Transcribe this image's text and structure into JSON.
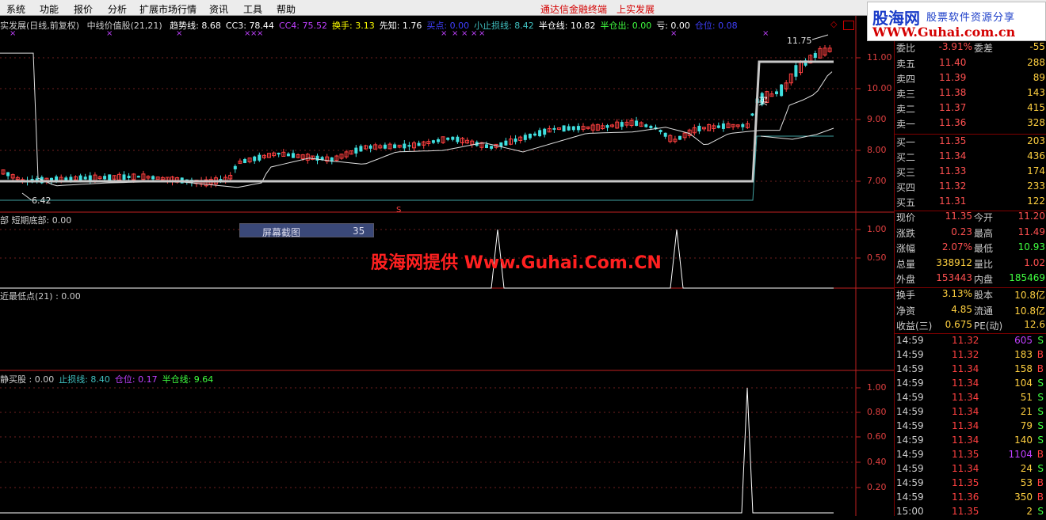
{
  "menu": {
    "items": [
      "系统",
      "功能",
      "报价",
      "分析",
      "扩展市场行情",
      "资讯",
      "工具",
      "帮助"
    ],
    "links": [
      "通达信金融终端",
      "上实发展"
    ]
  },
  "logo": {
    "name": "股海网",
    "tag": "股票软件资源分享",
    "url": "WWW.Guhai.com.cn"
  },
  "main": {
    "title": "实发展(日线,前复权)",
    "indicator": "中线价值股(21,21)",
    "values": [
      {
        "label": "趋势线: 8.68",
        "color": "#ffffff"
      },
      {
        "label": "CC3: 78.44",
        "color": "#ffffff"
      },
      {
        "label": "CC4: 75.52",
        "color": "#c040ff"
      },
      {
        "label": "换手: 3.13",
        "color": "#ffff00"
      },
      {
        "label": "先知: 1.76",
        "color": "#ffffff"
      },
      {
        "label": "买点: 0.00",
        "color": "#4040ff"
      },
      {
        "label": "小止损线: 8.42",
        "color": "#40c0c0"
      },
      {
        "label": "半仓线: 10.82",
        "color": "#ffffff"
      },
      {
        "label": "半仓出: 0.00",
        "color": "#40ff40"
      },
      {
        "label": "亏: 0.00",
        "color": "#ffffff"
      },
      {
        "label": "仓位: 0.08",
        "color": "#4040ff"
      }
    ],
    "high_label": "11.75",
    "low_label": "6.42",
    "buy_label": "买",
    "s_mark": "S",
    "axis": [
      "11.00",
      "10.00",
      "9.00",
      "8.00",
      "7.00"
    ]
  },
  "panel2": {
    "title": "部 短期底部: 0.00",
    "axis": [
      "1.00",
      "0.50"
    ]
  },
  "panel3": {
    "title": "近最低点(21) : 0.00"
  },
  "panel4": {
    "values": [
      {
        "label": "静买股 : 0.00",
        "color": "#cccccc"
      },
      {
        "label": "止损线: 8.40",
        "color": "#40c0c0"
      },
      {
        "label": "仓位: 0.17",
        "color": "#c040ff"
      },
      {
        "label": "半仓线: 9.64",
        "color": "#40ff40"
      }
    ],
    "axis": [
      "1.00",
      "0.80",
      "0.60",
      "0.40",
      "0.20"
    ]
  },
  "capture": {
    "label": "屏幕截图",
    "count": "35"
  },
  "watermark": "股海网提供 Www.Guhai.Com.CN",
  "quote": {
    "top": {
      "k1": "委比",
      "v1": "-3.91%",
      "k2": "委差",
      "v2": "-55"
    },
    "sells": [
      {
        "label": "卖五",
        "price": "11.40",
        "vol": "288"
      },
      {
        "label": "卖四",
        "price": "11.39",
        "vol": "89"
      },
      {
        "label": "卖三",
        "price": "11.38",
        "vol": "143"
      },
      {
        "label": "卖二",
        "price": "11.37",
        "vol": "415"
      },
      {
        "label": "卖一",
        "price": "11.36",
        "vol": "328"
      }
    ],
    "buys": [
      {
        "label": "买一",
        "price": "11.35",
        "vol": "203"
      },
      {
        "label": "买二",
        "price": "11.34",
        "vol": "436"
      },
      {
        "label": "买三",
        "price": "11.33",
        "vol": "174"
      },
      {
        "label": "买四",
        "price": "11.32",
        "vol": "233"
      },
      {
        "label": "买五",
        "price": "11.31",
        "vol": "122"
      }
    ],
    "stats": [
      {
        "k1": "现价",
        "v1": "11.35",
        "c1": "#ff5050",
        "k2": "今开",
        "v2": "11.20",
        "c2": "#ff5050"
      },
      {
        "k1": "涨跌",
        "v1": "0.23",
        "c1": "#ff5050",
        "k2": "最高",
        "v2": "11.49",
        "c2": "#ff5050"
      },
      {
        "k1": "涨幅",
        "v1": "2.07%",
        "c1": "#ff5050",
        "k2": "最低",
        "v2": "10.93",
        "c2": "#40ff40"
      },
      {
        "k1": "总量",
        "v1": "338912",
        "c1": "#ffd040",
        "k2": "量比",
        "v2": "1.02",
        "c2": "#ff5050"
      },
      {
        "k1": "外盘",
        "v1": "153443",
        "c1": "#ff5050",
        "k2": "内盘",
        "v2": "185469",
        "c2": "#40ff40"
      }
    ],
    "stats2": [
      {
        "k1": "换手",
        "v1": "3.13%",
        "c1": "#ffd040",
        "k2": "股本",
        "v2": "10.8亿",
        "c2": "#ffd040"
      },
      {
        "k1": "净资",
        "v1": "4.85",
        "c1": "#ffd040",
        "k2": "流通",
        "v2": "10.8亿",
        "c2": "#ffd040"
      },
      {
        "k1": "收益(三)",
        "v1": "0.675",
        "c1": "#ffd040",
        "k2": "PE(动)",
        "v2": "12.6",
        "c2": "#ffd040"
      }
    ],
    "ticks": [
      {
        "time": "14:59",
        "price": "11.32",
        "vol": "605",
        "flag": "S",
        "vc": "#c040ff"
      },
      {
        "time": "14:59",
        "price": "11.32",
        "vol": "183",
        "flag": "B"
      },
      {
        "time": "14:59",
        "price": "11.34",
        "vol": "158",
        "flag": "B"
      },
      {
        "time": "14:59",
        "price": "11.34",
        "vol": "104",
        "flag": "S"
      },
      {
        "time": "14:59",
        "price": "11.34",
        "vol": "51",
        "flag": "S"
      },
      {
        "time": "14:59",
        "price": "11.34",
        "vol": "21",
        "flag": "S"
      },
      {
        "time": "14:59",
        "price": "11.34",
        "vol": "79",
        "flag": "S"
      },
      {
        "time": "14:59",
        "price": "11.34",
        "vol": "140",
        "flag": "S"
      },
      {
        "time": "14:59",
        "price": "11.35",
        "vol": "1104",
        "flag": "B",
        "vc": "#c040ff"
      },
      {
        "time": "14:59",
        "price": "11.34",
        "vol": "24",
        "flag": "S"
      },
      {
        "time": "14:59",
        "price": "11.35",
        "vol": "53",
        "flag": "B"
      },
      {
        "time": "14:59",
        "price": "11.36",
        "vol": "350",
        "flag": "B"
      },
      {
        "time": "15:00",
        "price": "11.35",
        "vol": "2",
        "flag": "S"
      }
    ]
  }
}
